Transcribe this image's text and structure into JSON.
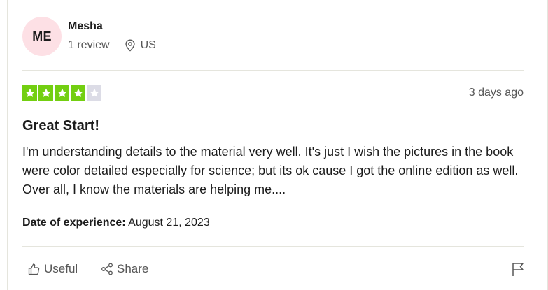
{
  "review": {
    "avatar_initials": "ME",
    "reviewer_name": "Mesha",
    "review_count": "1 review",
    "country": "US",
    "rating": 4,
    "rating_max": 5,
    "date_posted": "3 days ago",
    "title": "Great Start!",
    "body": "I'm understanding details to the material very well. It's just I wish the pictures in the book were color detailed especially for science; but its ok cause I got the online edition as well. Over all, I know the materials are helping me....",
    "experience_label": "Date of experience:",
    "experience_date": "August 21, 2023"
  },
  "actions": {
    "useful_label": "Useful",
    "share_label": "Share"
  },
  "icons": {
    "location": "location-pin-icon",
    "useful": "thumbs-up-icon",
    "share": "share-icon",
    "report": "flag-icon"
  },
  "colors": {
    "star_filled": "#73cf11",
    "star_empty": "#dcdce6",
    "avatar_bg": "#fde0e5"
  }
}
